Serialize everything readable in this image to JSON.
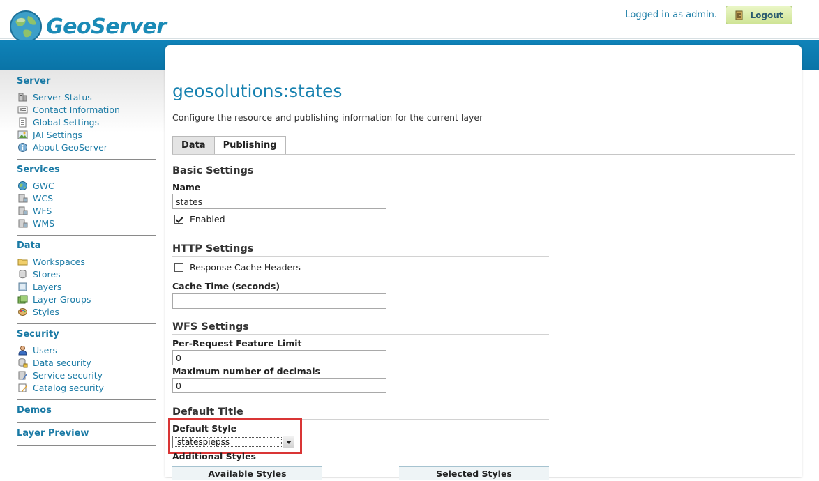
{
  "header": {
    "logo_text": "GeoServer",
    "login_text": "Logged in as admin.",
    "logout_label": "Logout"
  },
  "sidebar": {
    "sections": [
      {
        "title": "Server",
        "items": [
          {
            "label": "Server Status",
            "icon": "server-status-icon"
          },
          {
            "label": "Contact Information",
            "icon": "contact-card-icon"
          },
          {
            "label": "Global Settings",
            "icon": "document-icon"
          },
          {
            "label": "JAI Settings",
            "icon": "image-icon"
          },
          {
            "label": "About GeoServer",
            "icon": "info-icon"
          }
        ]
      },
      {
        "title": "Services",
        "items": [
          {
            "label": "GWC",
            "icon": "globe-icon"
          },
          {
            "label": "WCS",
            "icon": "service-icon"
          },
          {
            "label": "WFS",
            "icon": "service-icon"
          },
          {
            "label": "WMS",
            "icon": "service-icon"
          }
        ]
      },
      {
        "title": "Data",
        "items": [
          {
            "label": "Workspaces",
            "icon": "folder-icon"
          },
          {
            "label": "Stores",
            "icon": "database-icon"
          },
          {
            "label": "Layers",
            "icon": "layer-icon"
          },
          {
            "label": "Layer Groups",
            "icon": "layer-group-icon"
          },
          {
            "label": "Styles",
            "icon": "palette-icon"
          }
        ]
      },
      {
        "title": "Security",
        "items": [
          {
            "label": "Users",
            "icon": "user-icon"
          },
          {
            "label": "Data security",
            "icon": "data-security-icon"
          },
          {
            "label": "Service security",
            "icon": "service-security-icon"
          },
          {
            "label": "Catalog security",
            "icon": "catalog-security-icon"
          }
        ]
      },
      {
        "title": "Demos",
        "items": []
      },
      {
        "title": "Layer Preview",
        "items": []
      }
    ]
  },
  "main": {
    "title": "geosolutions:states",
    "description": "Configure the resource and publishing information for the current layer",
    "tabs": [
      {
        "label": "Data",
        "active": false
      },
      {
        "label": "Publishing",
        "active": true
      }
    ],
    "basic_settings": {
      "title": "Basic Settings",
      "name_label": "Name",
      "name_value": "states",
      "enabled_label": "Enabled",
      "enabled": true
    },
    "http_settings": {
      "title": "HTTP Settings",
      "cache_headers_label": "Response Cache Headers",
      "cache_headers": false,
      "cache_time_label": "Cache Time (seconds)",
      "cache_time_value": ""
    },
    "wfs_settings": {
      "title": "WFS Settings",
      "feature_limit_label": "Per-Request Feature Limit",
      "feature_limit_value": "0",
      "decimals_label": "Maximum number of decimals",
      "decimals_value": "0"
    },
    "default_title": {
      "title": "Default Title",
      "default_style_label": "Default Style",
      "default_style_value": "statespiepss",
      "additional_styles_label": "Additional Styles",
      "available_styles_label": "Available Styles",
      "selected_styles_label": "Selected Styles"
    }
  },
  "colors": {
    "link": "#1a7aa5",
    "title": "#1882b0",
    "band": "#0f83b9",
    "highlight": "#d93535",
    "logout_bg": "#d9eba9"
  }
}
